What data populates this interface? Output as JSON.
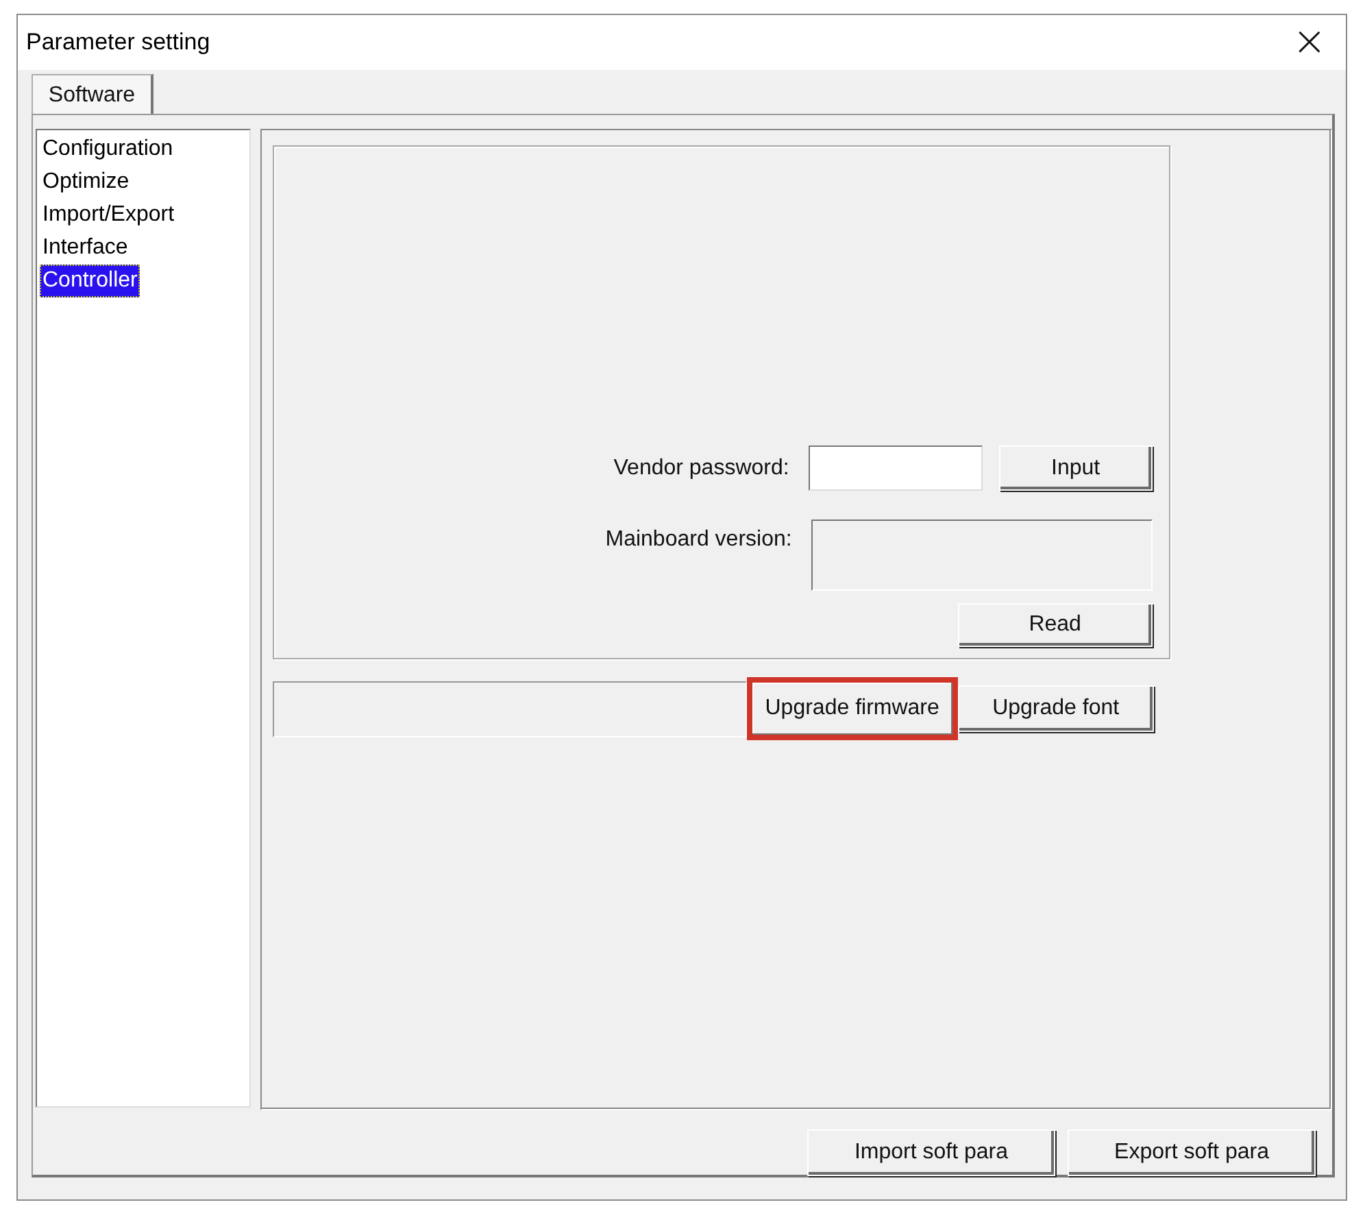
{
  "window": {
    "title": "Parameter setting",
    "close": "×"
  },
  "tabs": [
    {
      "label": "Software",
      "selected": true
    }
  ],
  "sidebar": {
    "items": [
      {
        "label": "Configuration",
        "selected": false
      },
      {
        "label": "Optimize",
        "selected": false
      },
      {
        "label": "Import/Export",
        "selected": false
      },
      {
        "label": "Interface",
        "selected": false
      },
      {
        "label": "Controller",
        "selected": true
      }
    ]
  },
  "controller": {
    "vendor_password": {
      "label": "Vendor password:",
      "button": "Input"
    },
    "mainboard_version": {
      "label": "Mainboard version:",
      "button": "Read"
    },
    "progress": {
      "level": 0
    },
    "upgrade_buttons": [
      {
        "label": "Upgrade firmware",
        "highlighted": true
      },
      {
        "label": "Upgrade font",
        "highlighted": false
      }
    ]
  },
  "footer_buttons": [
    "Import soft para",
    "Export soft para"
  ]
}
